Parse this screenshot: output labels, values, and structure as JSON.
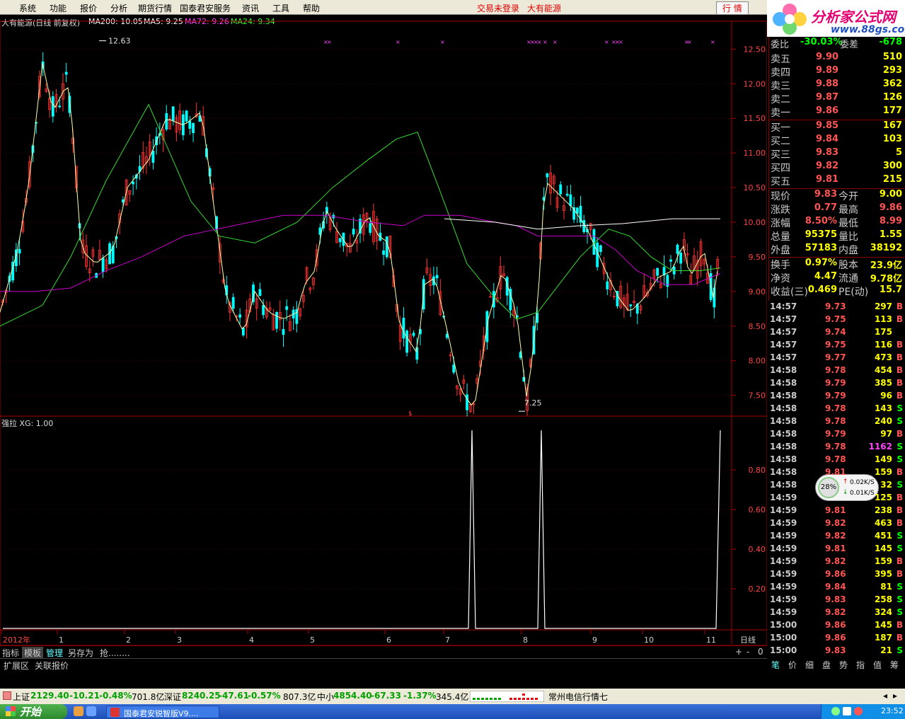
{
  "menu": {
    "items": [
      "系统",
      "功能",
      "报价",
      "分析",
      "期货行情",
      "国泰君安服务",
      "资讯",
      "工具",
      "帮助"
    ],
    "login_status": "交易未登录",
    "stock_name": "大有能源",
    "quote_button": "行 情"
  },
  "logo": {
    "title": "分析家公式网",
    "url": "www.88gs.com"
  },
  "chart": {
    "title": "大有能源(日线 前复权)",
    "ma200": "MA200: 10.05",
    "ma5": "MA5: 9.25",
    "ma72": "MA72: 9.26",
    "ma24": "MA24: 9.34",
    "high_label": "12.63",
    "low_label": "7.25",
    "price_ticks": [
      "12.50",
      "12.00",
      "11.50",
      "11.00",
      "10.50",
      "10.00",
      "9.50",
      "9.00",
      "8.50",
      "8.00",
      "7.50"
    ],
    "indicator_title": "强拉 XG: 1.00",
    "indicator_ticks": [
      "0.80",
      "0.60",
      "0.40",
      "0.20"
    ],
    "date_labels": [
      "2012年",
      "1",
      "2",
      "3",
      "4",
      "5",
      "6",
      "7",
      "8",
      "9",
      "10",
      "11"
    ],
    "period": "日线",
    "colors": {
      "ma5": "#ffffff",
      "ma24": "#00cc00",
      "ma72": "#cc00cc",
      "ma200": "#ffffff",
      "up": "#ff3333",
      "down": "#00ffff"
    }
  },
  "quote": {
    "weibi": {
      "label": "委比",
      "value": "-30.03%",
      "diff_label": "委差",
      "diff": "-678"
    },
    "asks": [
      {
        "label": "卖五",
        "price": "9.90",
        "vol": "510"
      },
      {
        "label": "卖四",
        "price": "9.89",
        "vol": "293"
      },
      {
        "label": "卖三",
        "price": "9.88",
        "vol": "362"
      },
      {
        "label": "卖二",
        "price": "9.87",
        "vol": "126"
      },
      {
        "label": "卖一",
        "price": "9.86",
        "vol": "177"
      }
    ],
    "bids": [
      {
        "label": "买一",
        "price": "9.85",
        "vol": "167"
      },
      {
        "label": "买二",
        "price": "9.84",
        "vol": "103"
      },
      {
        "label": "买三",
        "price": "9.83",
        "vol": "5"
      },
      {
        "label": "买四",
        "price": "9.82",
        "vol": "300"
      },
      {
        "label": "买五",
        "price": "9.81",
        "vol": "215"
      }
    ],
    "stats": [
      {
        "l1": "现价",
        "v1": "9.83",
        "l2": "今开",
        "v2": "9.00"
      },
      {
        "l1": "涨跌",
        "v1": "0.77",
        "l2": "最高",
        "v2": "9.86"
      },
      {
        "l1": "涨幅",
        "v1": "8.50%",
        "l2": "最低",
        "v2": "8.99"
      },
      {
        "l1": "总量",
        "v1": "95375",
        "l2": "量比",
        "v2": "1.55"
      },
      {
        "l1": "外盘",
        "v1": "57183",
        "l2": "内盘",
        "v2": "38192"
      },
      {
        "l1": "换手",
        "v1": "0.97%",
        "l2": "股本",
        "v2": "23.9亿"
      },
      {
        "l1": "净资",
        "v1": "4.47",
        "l2": "流通",
        "v2": "9.78亿"
      },
      {
        "l1": "收益(三)",
        "v1": "0.469",
        "l2": "PE(动)",
        "v2": "15.7"
      }
    ]
  },
  "ticks": [
    {
      "t": "14:57",
      "p": "9.73",
      "v": "297",
      "d": "B"
    },
    {
      "t": "14:57",
      "p": "9.75",
      "v": "113",
      "d": "B"
    },
    {
      "t": "14:57",
      "p": "9.74",
      "v": "175",
      "d": ""
    },
    {
      "t": "14:57",
      "p": "9.75",
      "v": "116",
      "d": "B"
    },
    {
      "t": "14:57",
      "p": "9.77",
      "v": "473",
      "d": "B"
    },
    {
      "t": "14:58",
      "p": "9.78",
      "v": "454",
      "d": "B"
    },
    {
      "t": "14:58",
      "p": "9.79",
      "v": "385",
      "d": "B"
    },
    {
      "t": "14:58",
      "p": "9.79",
      "v": "96",
      "d": "B"
    },
    {
      "t": "14:58",
      "p": "9.78",
      "v": "143",
      "d": "S"
    },
    {
      "t": "14:58",
      "p": "9.78",
      "v": "240",
      "d": "S"
    },
    {
      "t": "14:58",
      "p": "9.79",
      "v": "97",
      "d": "B"
    },
    {
      "t": "14:58",
      "p": "9.78",
      "v": "1162",
      "d": "S"
    },
    {
      "t": "14:58",
      "p": "9.78",
      "v": "149",
      "d": "S"
    },
    {
      "t": "14:58",
      "p": "9.81",
      "v": "159",
      "d": "B"
    },
    {
      "t": "14:58",
      "p": "",
      "v": "32",
      "d": "S"
    },
    {
      "t": "14:59",
      "p": "",
      "v": "125",
      "d": "B"
    },
    {
      "t": "14:59",
      "p": "9.81",
      "v": "238",
      "d": "B"
    },
    {
      "t": "14:59",
      "p": "9.82",
      "v": "463",
      "d": "B"
    },
    {
      "t": "14:59",
      "p": "9.82",
      "v": "451",
      "d": "S"
    },
    {
      "t": "14:59",
      "p": "9.81",
      "v": "145",
      "d": "S"
    },
    {
      "t": "14:59",
      "p": "9.82",
      "v": "159",
      "d": "B"
    },
    {
      "t": "14:59",
      "p": "9.86",
      "v": "395",
      "d": "B"
    },
    {
      "t": "14:59",
      "p": "9.84",
      "v": "81",
      "d": "S"
    },
    {
      "t": "14:59",
      "p": "9.83",
      "v": "258",
      "d": "S"
    },
    {
      "t": "14:59",
      "p": "9.82",
      "v": "324",
      "d": "S"
    },
    {
      "t": "15:00",
      "p": "9.86",
      "v": "145",
      "d": "B"
    },
    {
      "t": "15:00",
      "p": "9.86",
      "v": "187",
      "d": "B"
    },
    {
      "t": "15:00",
      "p": "9.83",
      "v": "21",
      "d": "S"
    }
  ],
  "panel_tabs": [
    "指标",
    "模板",
    "管理",
    "另存为",
    "抢........"
  ],
  "ext_tabs": [
    "扩展区",
    "关联报价"
  ],
  "right_tabs": [
    "笔",
    "价",
    "细",
    "盘",
    "势",
    "指",
    "值",
    "筹"
  ],
  "speed": {
    "pct": "28%",
    "up": "0.02K/S",
    "down": "0.01K/S"
  },
  "status": {
    "sh": {
      "label": "上证",
      "value": "2129.40",
      "chg": "-10.21",
      "pct": "-0.48%",
      "amt": "701.8亿"
    },
    "sz": {
      "label": "深证",
      "value": "8240.25",
      "chg": "-47.61",
      "pct": "-0.57%",
      "amt": "807.3亿"
    },
    "zx": {
      "label": "中小",
      "value": "4854.40",
      "chg": "-67.33",
      "pct": "-1.37%",
      "amt": "345.4亿"
    },
    "server": "常州电信行情七"
  },
  "taskbar": {
    "start": "开始",
    "task": "国泰君安锐智版V9....",
    "clock": "23:52"
  },
  "chart_data": {
    "type": "line",
    "title": "大有能源(日线 前复权)",
    "ylim": [
      7.2,
      12.8
    ],
    "x": [
      "2012年",
      "1",
      "2",
      "3",
      "4",
      "5",
      "6",
      "7",
      "8",
      "9",
      "10",
      "11"
    ],
    "series": [
      {
        "name": "MA5",
        "values": [
          8.8,
          9.7,
          12.0,
          9.2,
          9.5,
          10.3,
          11.5,
          8.0,
          7.6,
          9.6,
          8.9,
          9.25
        ]
      },
      {
        "name": "MA24",
        "values": [
          8.5,
          9.2,
          11.7,
          10.0,
          9.6,
          10.4,
          11.1,
          9.6,
          8.4,
          9.2,
          9.3,
          9.34
        ]
      },
      {
        "name": "MA72",
        "values": [
          9.0,
          9.1,
          9.8,
          10.2,
          10.5,
          10.5,
          10.4,
          10.2,
          10.0,
          9.8,
          9.2,
          9.26
        ]
      },
      {
        "name": "MA200",
        "values": [
          10.1,
          10.0,
          9.95,
          9.98,
          10.05
        ]
      }
    ],
    "indicator": {
      "name": "强拉 XG",
      "values": [
        0,
        0,
        0,
        0,
        0,
        0,
        0,
        1,
        1,
        0,
        0,
        1
      ],
      "ylim": [
        0,
        1
      ]
    }
  }
}
